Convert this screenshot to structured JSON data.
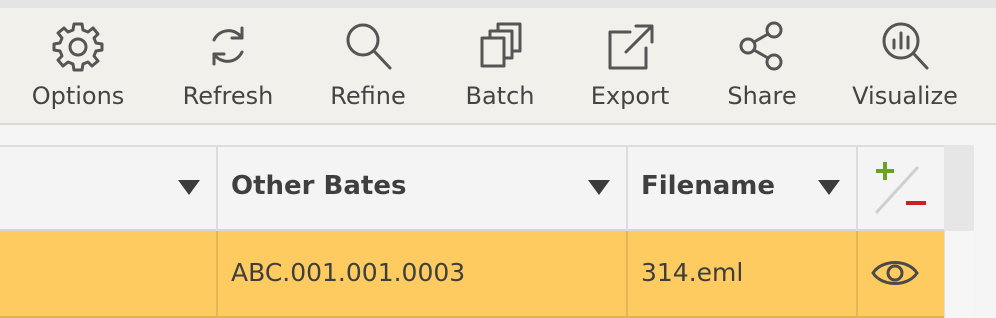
{
  "toolbar": {
    "items": [
      {
        "label": "Options",
        "icon": "gear-icon"
      },
      {
        "label": "Refresh",
        "icon": "refresh-icon"
      },
      {
        "label": "Refine",
        "icon": "magnifier-icon"
      },
      {
        "label": "Batch",
        "icon": "stacked-pages-icon"
      },
      {
        "label": "Export",
        "icon": "export-icon"
      },
      {
        "label": "Share",
        "icon": "share-icon"
      },
      {
        "label": "Visualize",
        "icon": "chart-magnifier-icon"
      }
    ]
  },
  "grid": {
    "columns": [
      {
        "label": ""
      },
      {
        "label": "Other Bates"
      },
      {
        "label": "Filename"
      }
    ],
    "column_picker_icon": "add-remove-columns-icon",
    "rows": [
      {
        "cells": [
          "",
          "ABC.001.001.0003",
          "314.eml"
        ],
        "action_icon": "eye-icon",
        "selected": true
      }
    ]
  },
  "colors": {
    "toolbar_bg": "#f2f0eb",
    "selected_row": "#fdcb60",
    "add_green": "#6aa321",
    "remove_red": "#cc1f1f"
  }
}
